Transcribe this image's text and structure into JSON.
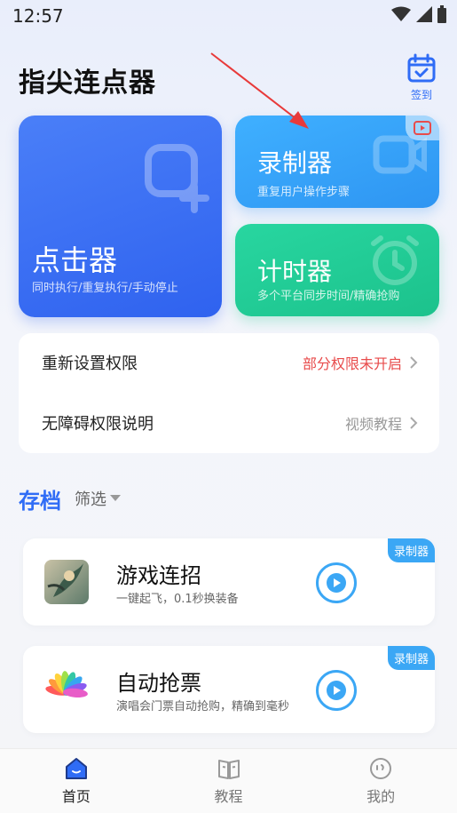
{
  "status_bar": {
    "time": "12:57"
  },
  "header": {
    "title": "指尖连点器",
    "checkin_label": "签到"
  },
  "cards": {
    "clicker": {
      "title": "点击器",
      "subtitle": "同时执行/重复执行/手动停止"
    },
    "recorder": {
      "title": "录制器",
      "subtitle": "重复用户操作步骤"
    },
    "timer": {
      "title": "计时器",
      "subtitle": "多个平台同步时间/精确抢购"
    }
  },
  "permissions": [
    {
      "label": "重新设置权限",
      "value": "部分权限未开启",
      "value_color": "#e84b4b"
    },
    {
      "label": "无障碍权限说明",
      "value": "视频教程",
      "value_color": "#999999"
    }
  ],
  "archive": {
    "title": "存档",
    "filter_label": "筛选"
  },
  "items": [
    {
      "title": "游戏连招",
      "desc": "一键起飞，0.1秒换装备",
      "tag": "录制器"
    },
    {
      "title": "自动抢票",
      "desc": "演唱会门票自动抢购，精确到毫秒",
      "tag": "录制器"
    }
  ],
  "nav": [
    {
      "label": "首页",
      "icon": "home-icon",
      "active": true
    },
    {
      "label": "教程",
      "icon": "book-icon",
      "active": false
    },
    {
      "label": "我的",
      "icon": "profile-icon",
      "active": false
    }
  ],
  "colors": {
    "accent": "#2f6cf6",
    "recorder_tag": "#3ba7f5",
    "alert": "#e84b4b"
  }
}
